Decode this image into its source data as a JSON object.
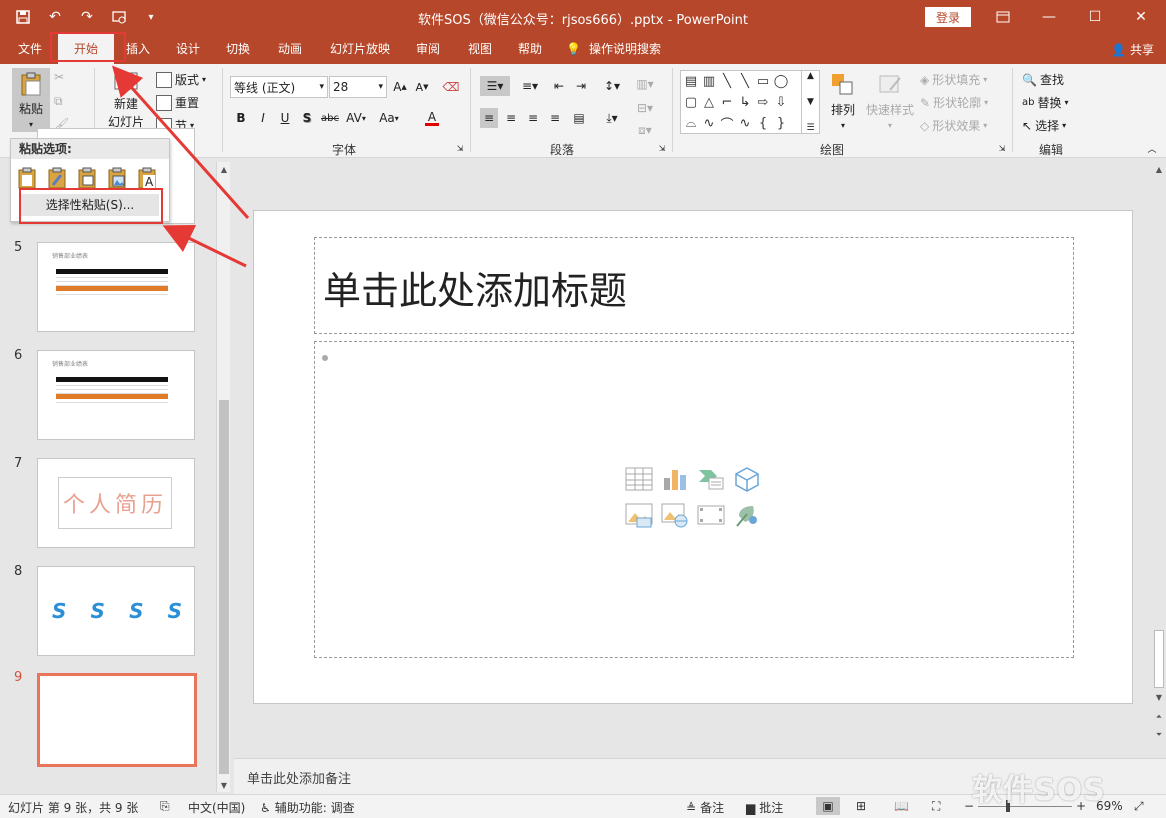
{
  "window": {
    "title": "软件SOS（微信公众号：rjsos666）.pptx  -  PowerPoint",
    "login_label": "登录",
    "share_label": "共享"
  },
  "tabs": [
    {
      "label": "文件"
    },
    {
      "label": "开始"
    },
    {
      "label": "插入"
    },
    {
      "label": "设计"
    },
    {
      "label": "切换"
    },
    {
      "label": "动画"
    },
    {
      "label": "幻灯片放映"
    },
    {
      "label": "审阅"
    },
    {
      "label": "视图"
    },
    {
      "label": "帮助"
    },
    {
      "label": "操作说明搜索"
    }
  ],
  "ribbon": {
    "clipboard": {
      "paste": "粘贴"
    },
    "slides": {
      "new_slide_1": "新建",
      "new_slide_2": "幻灯片",
      "layout": "版式",
      "reset": "重置",
      "section": "节"
    },
    "font": {
      "label": "字体",
      "font_name": "等线 (正文)",
      "font_size": "28",
      "bold": "B",
      "italic": "I",
      "underline": "U",
      "shadow": "S",
      "strike": "abc",
      "spacing": "AV",
      "case": "Aa",
      "color": "A"
    },
    "paragraph": {
      "label": "段落"
    },
    "drawing": {
      "label": "绘图",
      "arrange": "排列",
      "quick_styles": "快速样式",
      "shape_fill": "形状填充",
      "shape_outline": "形状轮廓",
      "shape_effects": "形状效果"
    },
    "editing": {
      "label": "编辑",
      "find": "查找",
      "replace": "替换",
      "select": "选择"
    }
  },
  "paste_dropdown": {
    "header": "粘贴选项:",
    "special": "选择性粘贴(S)..."
  },
  "thumbnails": [
    {
      "num": "5",
      "caption": "销售部业绩表"
    },
    {
      "num": "6",
      "caption": "销售部业绩表"
    },
    {
      "num": "7",
      "caption": "个人简历"
    },
    {
      "num": "8"
    },
    {
      "num": "9"
    }
  ],
  "slide": {
    "title_placeholder": "单击此处添加标题"
  },
  "notes": {
    "placeholder": "单击此处添加备注"
  },
  "status": {
    "slide_info": "幻灯片 第 9 张，共 9 张",
    "language": "中文(中国)",
    "accessibility": "辅助功能: 调查",
    "notes": "备注",
    "comments": "批注",
    "zoom": "69%"
  },
  "watermark": "软件SOS",
  "colors": {
    "accent": "#b7472a",
    "highlight": "#e53935",
    "selected_thumb": "#e8745a"
  }
}
